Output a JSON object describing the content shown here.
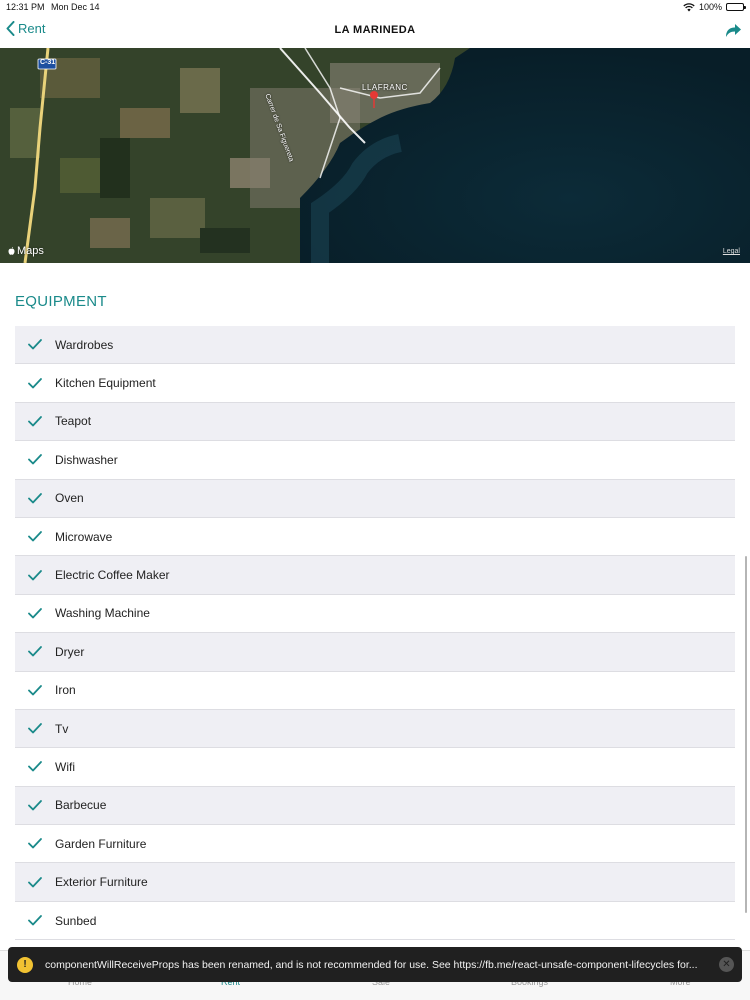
{
  "status_bar": {
    "time": "12:31 PM",
    "date": "Mon Dec 14",
    "battery": "100%"
  },
  "nav": {
    "back_label": "Rent",
    "title": "LA MARINEDA"
  },
  "map": {
    "road_label": "C-31",
    "town_label": "LLAFRANC",
    "street_label": "Carrer de Sa Figuereta",
    "logo": "Maps",
    "legal": "Legal"
  },
  "section_title": "EQUIPMENT",
  "equipment": [
    "Wardrobes",
    "Kitchen Equipment",
    "Teapot",
    "Dishwasher",
    "Oven",
    "Microwave",
    "Electric Coffee Maker",
    "Washing Machine",
    "Dryer",
    "Iron",
    "Tv",
    "Wifi",
    "Barbecue",
    "Garden Furniture",
    "Exterior Furniture",
    "Sunbed"
  ],
  "tabs": [
    {
      "label": "Home",
      "icon": "home-icon"
    },
    {
      "label": "Rent",
      "icon": "waves-icon"
    },
    {
      "label": "Sale",
      "icon": "key-icon"
    },
    {
      "label": "Bookings",
      "icon": "list-icon"
    },
    {
      "label": "More",
      "icon": "more-icon"
    }
  ],
  "toast": {
    "message": "componentWillReceiveProps has been renamed, and is not recommended for use. See https://fb.me/react-unsafe-component-lifecycles for...",
    "icon": "!",
    "close": "✕"
  },
  "colors": {
    "accent": "#1a8a8a",
    "row_shade": "#efeff4"
  }
}
